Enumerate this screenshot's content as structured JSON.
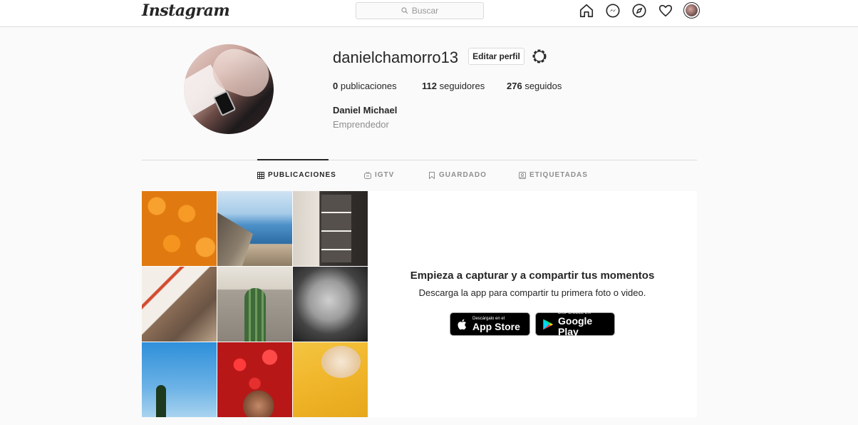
{
  "nav": {
    "logo": "Instagram",
    "search_placeholder": "Buscar",
    "icons": [
      "home-icon",
      "messenger-icon",
      "explore-icon",
      "heart-icon",
      "avatar"
    ]
  },
  "profile": {
    "username": "danielchamorro13",
    "edit_label": "Editar perfil",
    "posts_count": "0",
    "posts_label": "publicaciones",
    "followers_count": "112",
    "followers_label": "seguidores",
    "following_count": "276",
    "following_label": "seguidos",
    "full_name": "Daniel Michael",
    "bio": "Emprendedor"
  },
  "tabs": [
    {
      "label": "PUBLICACIONES",
      "icon": "grid-icon",
      "active": true
    },
    {
      "label": "IGTV",
      "icon": "igtv-icon",
      "active": false
    },
    {
      "label": "GUARDADO",
      "icon": "bookmark-icon",
      "active": false
    },
    {
      "label": "ETIQUETADAS",
      "icon": "tagged-icon",
      "active": false
    }
  ],
  "cta": {
    "title": "Empieza a capturar y a compartir tus momentos",
    "subtitle": "Descarga la app para compartir tu primera foto o video.",
    "appstore_small": "Descárgalo en el",
    "appstore_big": "App Store",
    "gplay_small": "DISPONIBLE EN",
    "gplay_big": "Google Play"
  }
}
